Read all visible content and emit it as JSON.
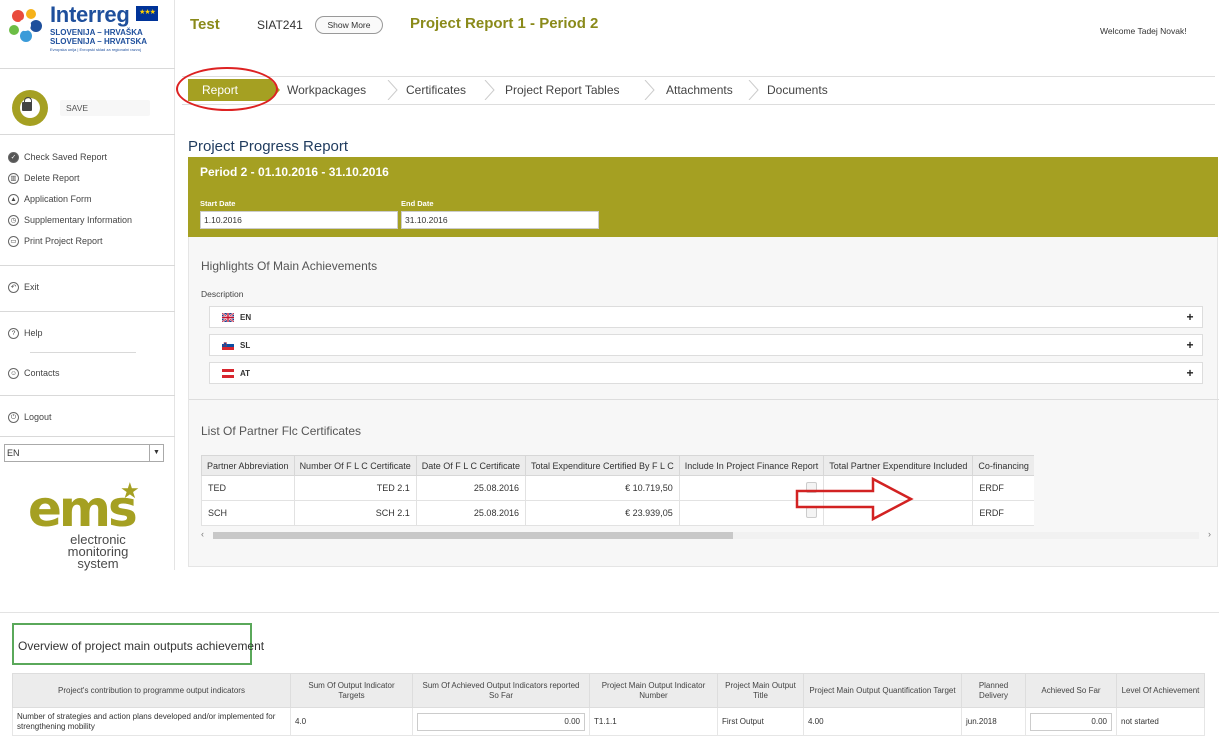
{
  "logo": {
    "brand": "Interreg",
    "line1": "SLOVENIJA – HRVAŠKA",
    "line2": "SLOVENIJA – HRVATSKA",
    "line3": "Evropska unija | Evropski sklad za regionalni razvoj",
    "eu_flag": "EU flag"
  },
  "sidebar": {
    "save_label": "SAVE",
    "items": [
      {
        "label": "Check Saved Report",
        "icon": "check-icon"
      },
      {
        "label": "Delete Report",
        "icon": "trash-icon"
      },
      {
        "label": "Application Form",
        "icon": "building-icon"
      },
      {
        "label": "Supplementary Information",
        "icon": "clock-icon"
      },
      {
        "label": "Print Project Report",
        "icon": "printer-icon"
      }
    ],
    "exit_label": "Exit",
    "help_label": "Help",
    "contacts_label": "Contacts",
    "logout_label": "Logout",
    "language_value": "EN",
    "ems_word": "ems",
    "ems_line1": "electronic",
    "ems_line2": "monitoring",
    "ems_line3": "system"
  },
  "header": {
    "project_short": "Test",
    "project_code": "SIAT241",
    "show_more": "Show More",
    "report_title": "Project Report 1 - Period 2",
    "welcome": "Welcome Tadej Novak!"
  },
  "tabs": [
    "Report",
    "Workpackages",
    "Certificates",
    "Project Report Tables",
    "Attachments",
    "Documents"
  ],
  "report": {
    "section_title": "Project Progress Report",
    "period_title": "Period 2 - 01.10.2016 - 31.10.2016",
    "start_label": "Start Date",
    "start_value": "1.10.2016",
    "end_label": "End Date",
    "end_value": "31.10.2016",
    "highlights_title": "Highlights Of Main Achievements",
    "description_label": "Description",
    "languages": [
      "EN",
      "SL",
      "AT"
    ],
    "certificates_title": "List Of Partner Flc Certificates",
    "cert_columns": [
      "Partner Abbreviation",
      "Number Of F L C Certificate",
      "Date Of F L C Certificate",
      "Total Expenditure Certified By F L C",
      "Include In Project Finance Report",
      "Total Partner Expenditure Included",
      "Co-financing"
    ],
    "cert_rows": [
      {
        "partner": "TED",
        "number": "TED 2.1",
        "date": "25.08.2016",
        "total": "€ 10.719,50",
        "included": "",
        "cofin": "ERDF"
      },
      {
        "partner": "SCH",
        "number": "SCH 2.1",
        "date": "25.08.2016",
        "total": "€ 23.939,05",
        "included": "",
        "cofin": "ERDF"
      }
    ],
    "colors": {
      "accent": "#a5a022",
      "annotation_red": "#d22222",
      "annotation_green": "#5aa85a"
    }
  },
  "outputs": {
    "title": "Overview of project main outputs achievement",
    "columns": [
      "Project's contribution to programme output indicators",
      "Sum Of Output Indicator Targets",
      "Sum Of Achieved Output Indicators reported So Far",
      "Project Main Output Indicator Number",
      "Project Main Output Title",
      "Project Main Output Quantification Target",
      "Planned Delivery",
      "Achieved So Far",
      "Level Of Achievement"
    ],
    "rows": [
      {
        "contribution": "Number of strategies and action plans developed and/or implemented for strengthening mobility",
        "sum_targets": "4.0",
        "sum_achieved": "0.00",
        "indicator_number": "T1.1.1",
        "output_title": "First Output",
        "quantification": "4.00",
        "planned": "jun.2018",
        "achieved": "0.00",
        "level": "not started"
      }
    ]
  }
}
